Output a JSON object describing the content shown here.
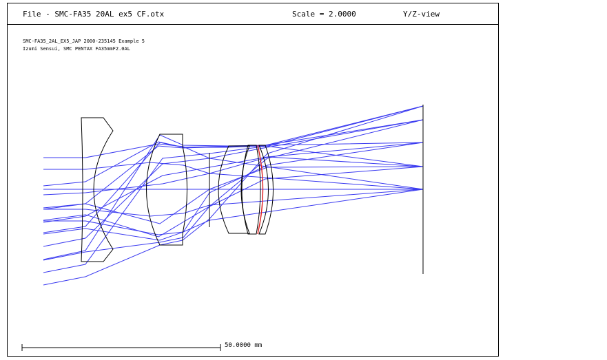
{
  "header": {
    "file": "File - SMC-FA35 20AL ex5 CF.otx",
    "scale": "Scale = 2.0000",
    "view": "Y/Z-view"
  },
  "notes": {
    "line1": "SMC-FA35_2AL_EX5_JAP 2000-235145 Example 5",
    "line2": "Izumi Sensui, SMC PENTAX FA35mmF2.0AL"
  },
  "scale_bar": {
    "label": "50.0000 mm"
  },
  "colors": {
    "rays": "#3a3af0",
    "lens": "#000000",
    "aspheric_surface": "#e02020"
  }
}
